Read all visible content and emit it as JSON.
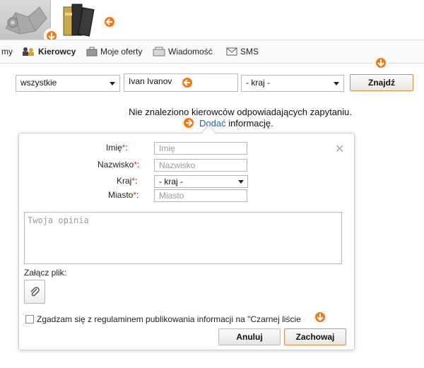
{
  "nav": {
    "items": [
      {
        "label": "my"
      },
      {
        "label": "Kierowcy"
      },
      {
        "label": "Moje oferty"
      },
      {
        "label": "Wiadomość"
      },
      {
        "label": "SMS"
      }
    ]
  },
  "search": {
    "type_value": "wszystkie",
    "name_value": "Ivan Ivanov",
    "country_value": "- kraj -",
    "find_label": "Znajdź"
  },
  "message": {
    "not_found": "Nie znaleziono kierowców odpowiadających zapytaniu.",
    "add_link": "Dodać",
    "add_rest": " informację."
  },
  "form": {
    "fields": [
      {
        "label": "Imię",
        "star": "*",
        "suffix": ":",
        "placeholder": "Imię"
      },
      {
        "label": "Nazwisko",
        "star": "*",
        "suffix": ":",
        "placeholder": "Nazwisko"
      },
      {
        "label": "Kraj",
        "star": "*",
        "suffix": ":",
        "value": "- kraj -"
      },
      {
        "label": "Miasto",
        "star": "*",
        "suffix": ":",
        "placeholder": "Miasto"
      }
    ],
    "opinion_placeholder": "Twoja opinia",
    "attach_label": "Załącz plik:",
    "consent_text": "Zgadzam się z regulaminem publikowania informacji na \"Czarnej liście",
    "cancel_label": "Anuluj",
    "save_label": "Zachowaj"
  },
  "colors": {
    "accent_orange": "#f07a1a",
    "link_blue": "#2a5db0",
    "required_red": "#d23b1f"
  }
}
